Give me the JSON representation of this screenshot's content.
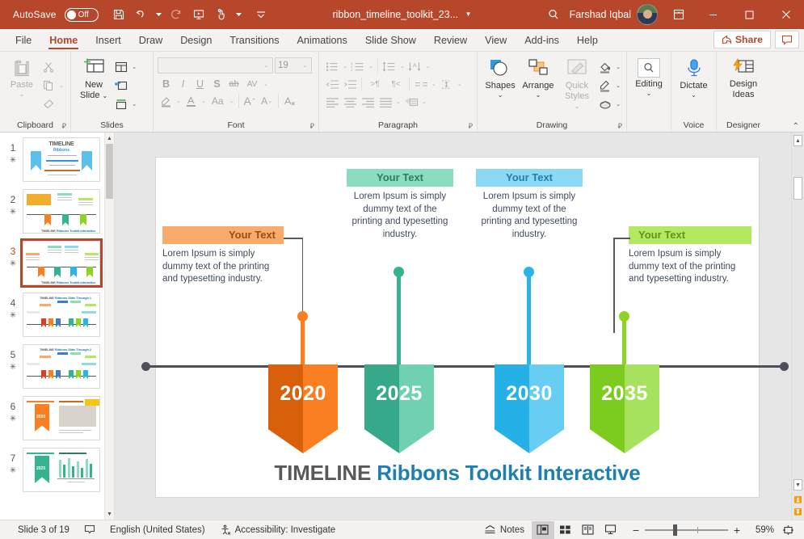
{
  "titlebar": {
    "autosave_label": "AutoSave",
    "autosave_state": "Off",
    "save_icon": "save-icon",
    "undo_icon": "undo-icon",
    "redo_icon": "redo-icon",
    "present_icon": "start-presentation-icon",
    "touch_icon": "touch-mode-icon",
    "customize_icon": "customize-quick-access-icon",
    "document_title": "ribbon_timeline_toolkit_23...",
    "search_icon": "search-icon",
    "account_name": "Farshad Iqbal",
    "ribbon_display_icon": "ribbon-display-options-icon",
    "minimize_label": "—",
    "maximize_label": "□",
    "close_label": "✕",
    "bg_color": "#b7472a"
  },
  "tabs": [
    {
      "label": "File",
      "active": false
    },
    {
      "label": "Home",
      "active": true
    },
    {
      "label": "Insert",
      "active": false
    },
    {
      "label": "Draw",
      "active": false
    },
    {
      "label": "Design",
      "active": false
    },
    {
      "label": "Transitions",
      "active": false
    },
    {
      "label": "Animations",
      "active": false
    },
    {
      "label": "Slide Show",
      "active": false
    },
    {
      "label": "Review",
      "active": false
    },
    {
      "label": "View",
      "active": false
    },
    {
      "label": "Add-ins",
      "active": false
    },
    {
      "label": "Help",
      "active": false
    }
  ],
  "tabstrip": {
    "share_label": "Share",
    "comment_icon": "comment-icon",
    "accent_color": "#b7472a"
  },
  "ribbon": {
    "groups": [
      {
        "name": "Clipboard",
        "label": "Clipboard"
      },
      {
        "name": "Slides",
        "label": "Slides"
      },
      {
        "name": "Font",
        "label": "Font"
      },
      {
        "name": "Paragraph",
        "label": "Paragraph"
      },
      {
        "name": "Drawing",
        "label": "Drawing"
      },
      {
        "name": "Voice",
        "label": "Voice"
      },
      {
        "name": "Designer",
        "label": "Designer"
      }
    ],
    "clipboard": {
      "paste_label": "Paste",
      "cut_icon": "cut-icon",
      "copy_icon": "copy-icon",
      "format_painter_icon": "format-painter-icon"
    },
    "slides": {
      "new_slide_label": "New\nSlide",
      "new_slide_line1": "New",
      "new_slide_line2": "Slide",
      "layout_icon": "slide-layout-icon",
      "reset_icon": "reset-slide-icon",
      "section_icon": "section-icon"
    },
    "font": {
      "font_name_value": "",
      "font_size_value": "19",
      "bold_label": "B",
      "italic_label": "I",
      "underline_label": "U",
      "shadow_label": "S",
      "strikethrough_label": "ab",
      "spacing_label": "AV",
      "highlight_icon": "text-highlight-icon",
      "font_color_icon": "font-color-icon",
      "change_case_label": "Aa",
      "grow_font_label": "A",
      "shrink_font_label": "A",
      "clear_format_icon": "clear-formatting-icon"
    },
    "paragraph": {
      "bullets_icon": "bullets-icon",
      "numbering_icon": "numbering-icon",
      "line_spacing_icon": "line-spacing-icon",
      "text_direction_icon": "text-direction-icon",
      "decrease_indent_icon": "decrease-indent-icon",
      "increase_indent_icon": "increase-indent-icon",
      "ltr_icon": "left-to-right-icon",
      "rtl_icon": "right-to-left-icon",
      "columns_icon": "columns-icon",
      "align_text_icon": "align-text-icon",
      "align_left_icon": "align-left-icon",
      "align_center_icon": "align-center-icon",
      "align_right_icon": "align-right-icon",
      "justify_icon": "justify-icon",
      "smartart_icon": "convert-to-smartart-icon"
    },
    "drawing": {
      "shapes_label": "Shapes",
      "arrange_label": "Arrange",
      "quick_styles_line1": "Quick",
      "quick_styles_line2": "Styles",
      "shape_fill_icon": "shape-fill-icon",
      "shape_outline_icon": "shape-outline-icon",
      "shape_effects_icon": "shape-effects-icon"
    },
    "editing": {
      "label": "Editing",
      "icon": "find-search-icon"
    },
    "voice": {
      "dictate_label": "Dictate",
      "icon": "microphone-icon"
    },
    "designer": {
      "line1": "Design",
      "line2": "Ideas",
      "icon": "design-ideas-icon"
    },
    "collapse_icon": "collapse-ribbon-icon"
  },
  "thumbnails": {
    "selected_index": 2,
    "scrollbar": "thumbnail-scrollbar",
    "items": [
      {
        "number": "1",
        "star": "✳"
      },
      {
        "number": "2",
        "star": "✳"
      },
      {
        "number": "3",
        "star": "✳"
      },
      {
        "number": "4",
        "star": "✳"
      },
      {
        "number": "5",
        "star": "✳"
      },
      {
        "number": "6",
        "star": "✳"
      },
      {
        "number": "7",
        "star": "✳"
      }
    ],
    "slide1_title_main": "TIMELINE",
    "slide1_title_sub": "Ribbons",
    "slide4_title": "TIMELINE Ribbons Slide Through 1",
    "slide5_title": "TIMELINE Ribbons Slide Through 2",
    "slide6_year": "2020",
    "slide7_year": "2025",
    "mini_title_main": "TIMELINE",
    "mini_title_sub": "Ribbons Toolkit Interactive"
  },
  "slide": {
    "title_part1": "TIMELINE ",
    "title_part2": "Ribbons Toolkit Interactive",
    "title_color1": "#595959",
    "title_color2": "#1f7fad",
    "timeline_color": "#4f4f5a",
    "callouts": [
      {
        "id": "callout-2020",
        "header": "Your Text",
        "body": "Lorem Ipsum is simply dummy text of the printing and typesetting industry.",
        "header_bg": "#f8ab6a",
        "header_text": "#9c4a17",
        "align": "right",
        "side": "left"
      },
      {
        "id": "callout-2025",
        "header": "Your Text",
        "body": "Lorem Ipsum is simply dummy text of the printing and typesetting industry.",
        "header_bg": "#8bdcc0",
        "header_text": "#2f7c63",
        "align": "center",
        "side": "above"
      },
      {
        "id": "callout-2030",
        "header": "Your Text",
        "body": "Lorem Ipsum is simply dummy text of the printing and typesetting industry.",
        "header_bg": "#8bd9f5",
        "header_text": "#1f7fad",
        "align": "center",
        "side": "above"
      },
      {
        "id": "callout-2035",
        "header": "Your Text",
        "body": "Lorem Ipsum is simply dummy text of the printing and typesetting industry.",
        "header_bg": "#b5e861",
        "header_text": "#5f9223",
        "align": "left",
        "side": "right"
      }
    ],
    "ribbons": [
      {
        "year": "2020",
        "dark": "#d9600b",
        "light": "#f97f22",
        "pin": "#f97f22"
      },
      {
        "year": "2025",
        "dark": "#35a98a",
        "light": "#6fd1b2",
        "pin": "#35b391"
      },
      {
        "year": "2030",
        "dark": "#25b0e6",
        "light": "#67cdf2",
        "pin": "#2ab4e8"
      },
      {
        "year": "2035",
        "dark": "#7ccc20",
        "light": "#a6e25e",
        "pin": "#8ed324"
      }
    ]
  },
  "statusbar": {
    "slide_indicator": "Slide 3 of 19",
    "notes_page_icon": "slide-notes-icon",
    "language": "English (United States)",
    "accessibility_icon": "accessibility-icon",
    "accessibility_text": "Accessibility: Investigate",
    "notes_label": "Notes",
    "view_normal_icon": "normal-view-icon",
    "view_sorter_icon": "slide-sorter-icon",
    "view_reading_icon": "reading-view-icon",
    "view_slideshow_icon": "slideshow-view-icon",
    "zoom_out_label": "−",
    "zoom_in_label": "+",
    "zoom_level": "59%",
    "fit_icon": "fit-slide-to-window-icon"
  }
}
